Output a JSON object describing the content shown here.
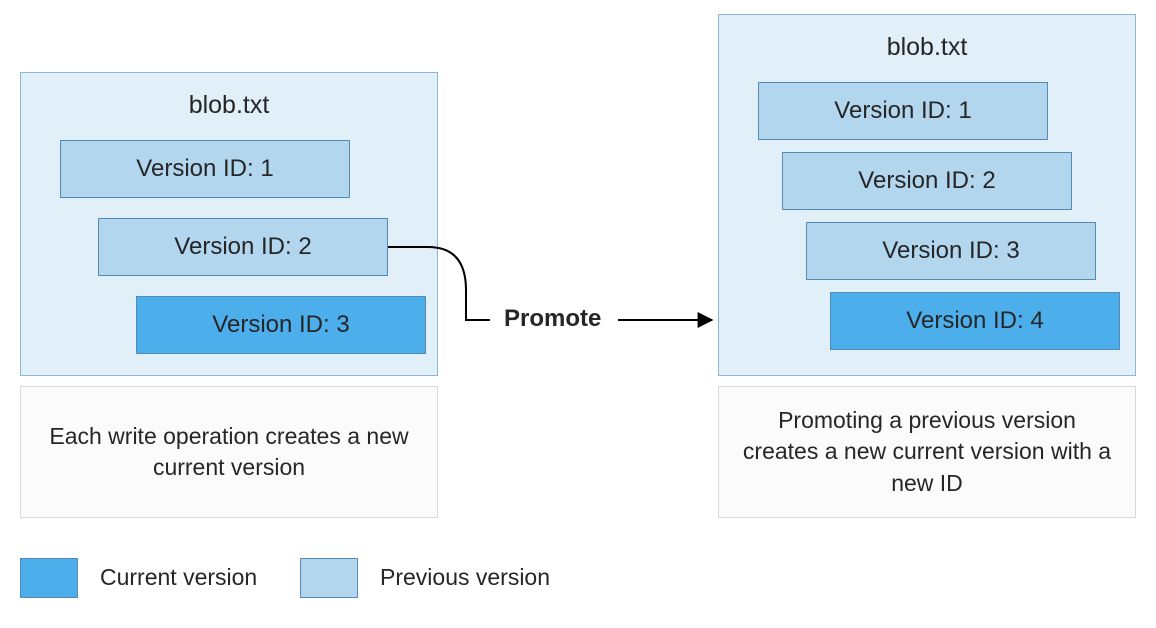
{
  "left": {
    "title": "blob.txt",
    "versions": [
      {
        "label": "Version ID: 1",
        "kind": "prev"
      },
      {
        "label": "Version ID: 2",
        "kind": "prev"
      },
      {
        "label": "Version ID: 3",
        "kind": "curr"
      }
    ],
    "caption": "Each write operation creates a new current version"
  },
  "right": {
    "title": "blob.txt",
    "versions": [
      {
        "label": "Version ID: 1",
        "kind": "prev"
      },
      {
        "label": "Version ID: 2",
        "kind": "prev"
      },
      {
        "label": "Version ID: 3",
        "kind": "prev"
      },
      {
        "label": "Version ID: 4",
        "kind": "curr"
      }
    ],
    "caption": "Promoting a previous version creates a new current version with a new ID"
  },
  "action": "Promote",
  "legend": {
    "current": "Current version",
    "previous": "Previous version"
  },
  "colors": {
    "panel_bg": "#e1f0f8",
    "panel_border": "#8fb6d1",
    "prev_bg": "#b3d6ef",
    "curr_bg": "#4caeea",
    "box_border": "#548ab5",
    "caption_bg": "#fbfbfb",
    "caption_border": "#d9d9d9"
  }
}
